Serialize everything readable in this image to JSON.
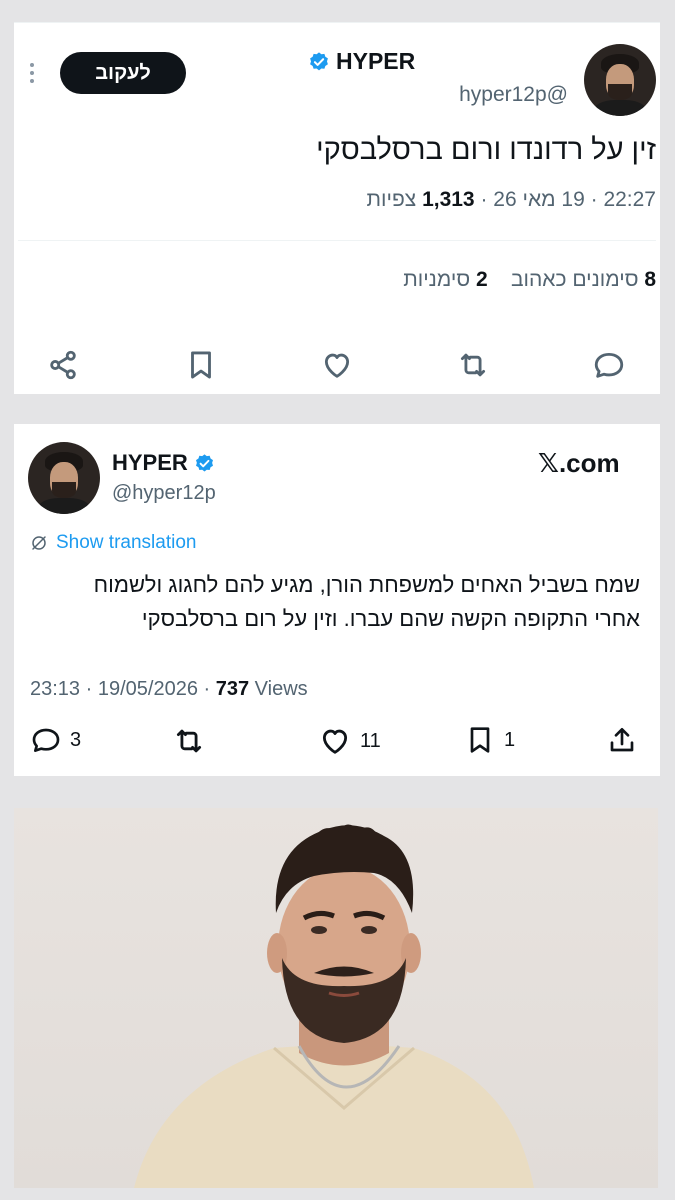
{
  "top_tweet": {
    "author": {
      "name": "HYPER",
      "handle": "@hyper12p"
    },
    "follow_label": "לעקוב",
    "text": "זין על רדונדו ורום ברסלבסקי",
    "meta": {
      "time": "22:27",
      "sep1": " · ",
      "date": "19 מאי 26",
      "sep2": " · ",
      "views_count": "1,313",
      "views_label": " צפיות"
    },
    "stats": {
      "likes_count": "8",
      "likes_label": " סימונים כאהוב",
      "bookmarks_count": "2",
      "bookmarks_label": " סימניות"
    },
    "actions": [
      "reply-icon",
      "retweet-icon",
      "like-icon",
      "bookmark-icon",
      "share-icon"
    ]
  },
  "embed_tweet": {
    "author": {
      "name": "HYPER",
      "handle": "@hyper12p"
    },
    "source": "𝕏.com",
    "show_translation": "Show translation",
    "text_line1": "שמח בשביל האחים למשפחת הורן, מגיע להם לחגוג ולשמוח",
    "text_line2": "אחרי התקופה הקשה שהם עברו. וזין על רום ברסלבסקי",
    "meta": {
      "time": "23:13",
      "sep1": " · ",
      "date": "19/05/2026",
      "sep2": " · ",
      "views_count": "737",
      "views_label": " Views"
    },
    "actions": {
      "reply_count": "3",
      "retweet_count": "",
      "like_count": "11",
      "bookmark_count": "1"
    }
  },
  "colors": {
    "verified": "#1d9bf0",
    "text": "#0f1419",
    "secondary": "#536471",
    "accent": "#1d9bf0"
  }
}
